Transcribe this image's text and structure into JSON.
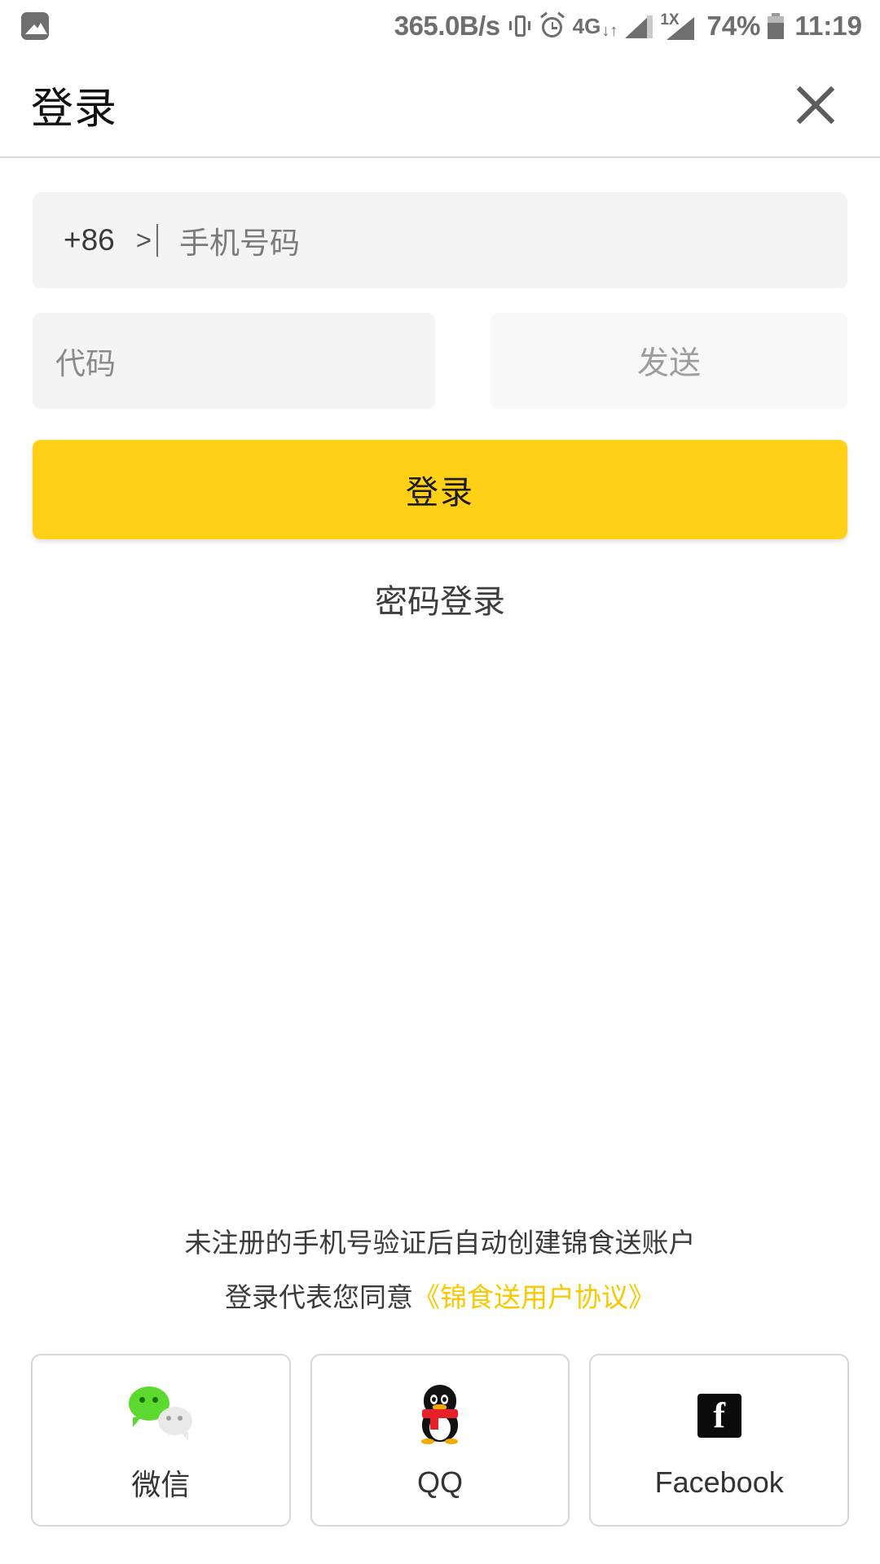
{
  "status_bar": {
    "notification_icon": "gallery-icon",
    "network_speed": "365.0B/s",
    "vibrate_icon": "vibrate-icon",
    "alarm_icon": "alarm-icon",
    "data_network": "4G",
    "data_arrows": "↓↑",
    "sim2_label": "1X",
    "battery_percent": "74%",
    "time": "11:19"
  },
  "header": {
    "title": "登录",
    "close_icon": "close-icon"
  },
  "form": {
    "country_code": "+86",
    "country_chevron": ">",
    "phone_placeholder": "手机号码",
    "code_placeholder": "代码",
    "send_code_label": "发送",
    "login_button_label": "登录",
    "password_login_label": "密码登录"
  },
  "footer": {
    "agreement_line1": "未注册的手机号验证后自动创建锦食送账户",
    "agreement_line2_prefix": "登录代表您同意",
    "agreement_link": "《锦食送用户协议》"
  },
  "social": {
    "wechat_label": "微信",
    "qq_label": "QQ",
    "facebook_label": "Facebook"
  },
  "colors": {
    "accent_yellow": "#FFD015",
    "link_yellow": "#FAC800",
    "field_gray": "#F4F4F4",
    "send_gray": "#F8F8F8",
    "status_gray": "#6E6E6E",
    "wechat_green": "#5CD92E",
    "qq_red": "#E8202A",
    "facebook_black": "#0B0B0B"
  }
}
